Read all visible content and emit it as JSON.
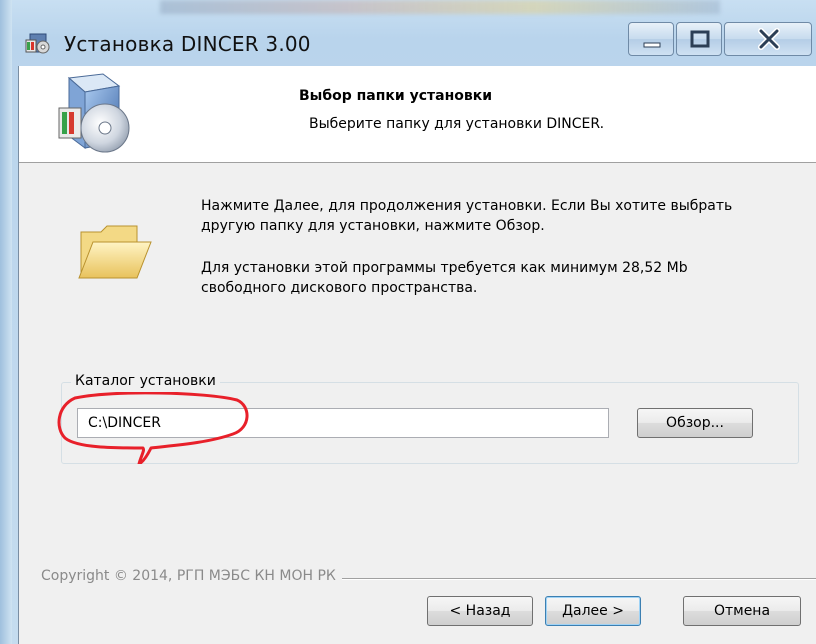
{
  "window": {
    "title": "Установка DINCER 3.00",
    "controls": {
      "minimize": "minimize",
      "maximize": "maximize",
      "close": "close"
    }
  },
  "banner": {
    "title": "Выбор папки установки",
    "subtitle": "Выберите папку для установки DINCER."
  },
  "body": {
    "instruction": "Нажмите Далее, для продолжения установки. Если Вы хотите выбрать другую папку для установки, нажмите Обзор.",
    "space_note": "Для установки этой программы требуется как минимум 28,52 Mb свободного дискового пространства."
  },
  "install_dir": {
    "group_label": "Каталог установки",
    "value": "C:\\DINCER",
    "browse_label": "Обзор..."
  },
  "footer": {
    "copyright": "Copyright © 2014, РГП МЭБС КН МОН РК",
    "back_label": "< Назад",
    "next_label": "Далее >",
    "cancel_label": "Отмена"
  },
  "icons": {
    "app": "installer-box-icon",
    "banner": "installer-cd-icon",
    "folder": "folder-icon"
  },
  "colors": {
    "annotation": "#e8202a",
    "frame": "#c5dcef",
    "client": "#f0f0f0"
  }
}
